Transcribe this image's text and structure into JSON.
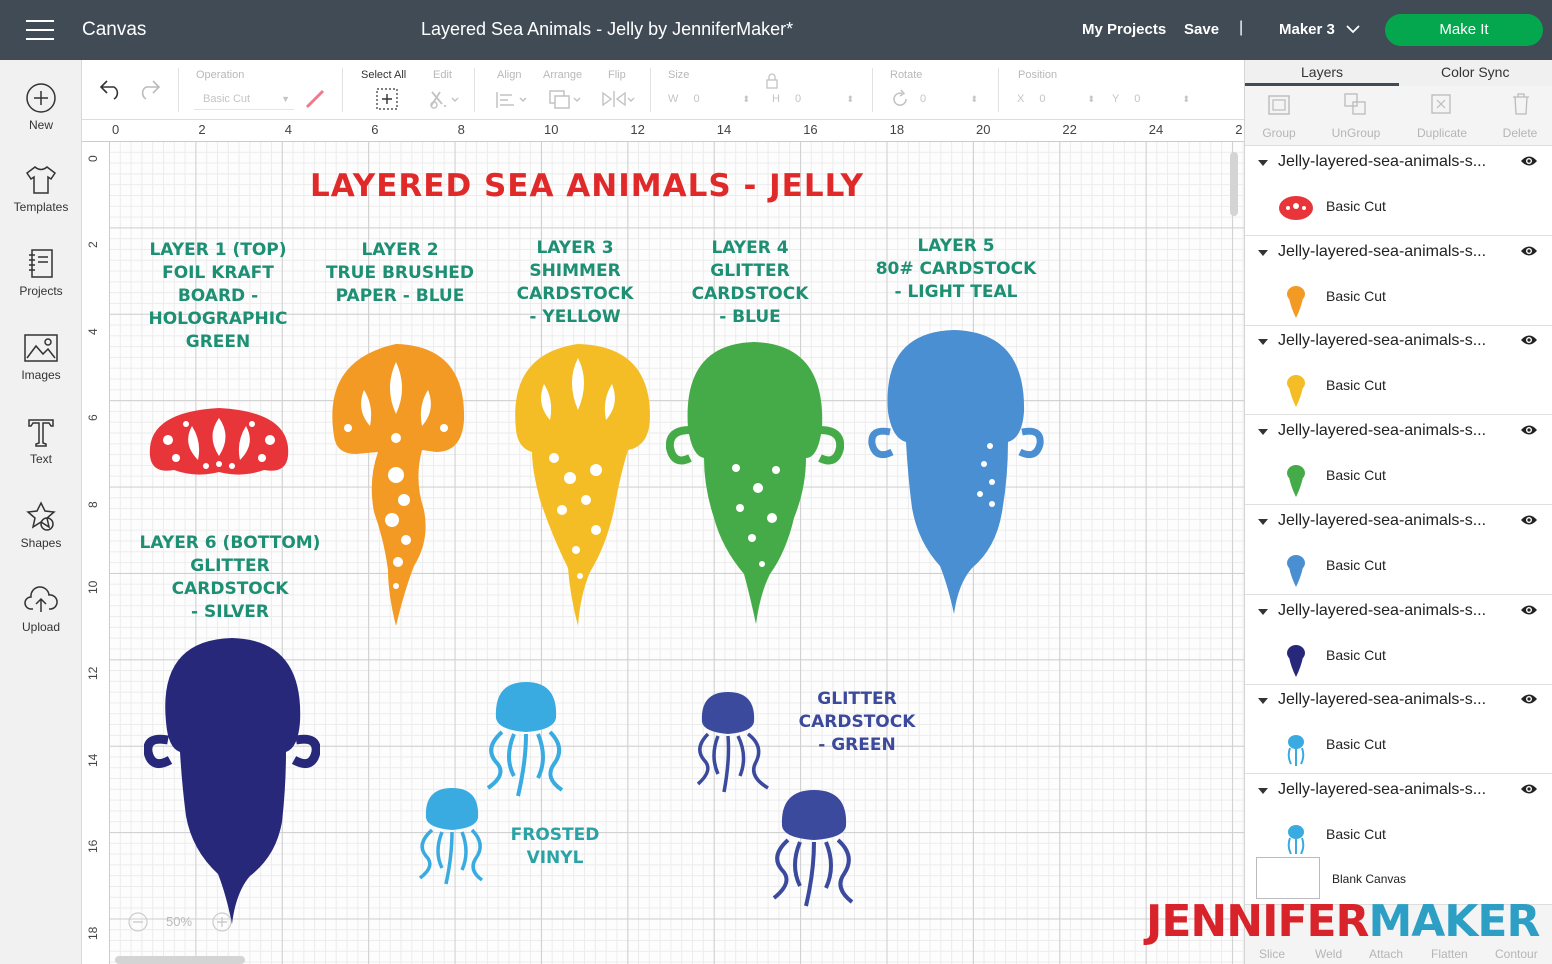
{
  "topbar": {
    "app_name": "Canvas",
    "doc_title": "Layered Sea Animals - Jelly by JenniferMaker*",
    "my_projects": "My Projects",
    "save": "Save",
    "separator": "|",
    "machine": "Maker 3",
    "make_it": "Make It",
    "make_it_color": "#04a74e"
  },
  "sidebar": {
    "items": [
      {
        "label": "New",
        "icon": "plus-circle-icon"
      },
      {
        "label": "Templates",
        "icon": "tshirt-icon"
      },
      {
        "label": "Projects",
        "icon": "notebook-icon"
      },
      {
        "label": "Images",
        "icon": "image-icon"
      },
      {
        "label": "Text",
        "icon": "text-icon"
      },
      {
        "label": "Shapes",
        "icon": "shapes-icon"
      },
      {
        "label": "Upload",
        "icon": "cloud-upload-icon"
      }
    ]
  },
  "toolbar": {
    "operation_label": "Operation",
    "operation_value": "Basic Cut",
    "select_all": "Select All",
    "edit": "Edit",
    "align": "Align",
    "arrange": "Arrange",
    "flip": "Flip",
    "size": "Size",
    "w": "W",
    "w_value": "0",
    "h": "H",
    "h_value": "0",
    "rotate": "Rotate",
    "rotate_value": "0",
    "position": "Position",
    "x": "X",
    "x_value": "0",
    "y": "Y",
    "y_value": "0"
  },
  "ruler": {
    "top": [
      "0",
      "2",
      "4",
      "6",
      "8",
      "10",
      "12",
      "14",
      "16",
      "18",
      "20",
      "22",
      "24",
      "2"
    ],
    "left": [
      "0",
      "2",
      "4",
      "6",
      "8",
      "10",
      "12",
      "14",
      "16",
      "18"
    ]
  },
  "canvas": {
    "title": "LAYERED SEA ANIMALS - JELLY",
    "labels": [
      "LAYER 1 (TOP)\nFOIL KRAFT\nBOARD -\nHOLOGRAPHIC\nGREEN",
      "LAYER 2\nTRUE BRUSHED\nPAPER - BLUE",
      "LAYER 3\nSHIMMER\nCARDSTOCK\n- YELLOW",
      "LAYER 4\nGLITTER\nCARDSTOCK\n- BLUE",
      "LAYER 5\n80# CARDSTOCK\n- LIGHT TEAL",
      "LAYER 6 (BOTTOM)\nGLITTER\nCARDSTOCK\n- SILVER"
    ],
    "note_frosted": "FROSTED\nVINYL",
    "note_glitter": "GLITTER\nCARDSTOCK\n- GREEN",
    "zoom": "50%",
    "colors": {
      "red": "#e8353a",
      "orange": "#f39a24",
      "yellow": "#f5bd25",
      "green": "#45ab48",
      "blue": "#4a8fd1",
      "navy": "#28287a",
      "sky": "#3aabe0",
      "indigo": "#3b4a9c",
      "label_teal": "#1d8f73",
      "frosted_teal": "#2aa3a6"
    }
  },
  "panel": {
    "tabs": [
      "Layers",
      "Color Sync"
    ],
    "actions": [
      "Group",
      "UnGroup",
      "Duplicate",
      "Delete"
    ],
    "layers": [
      {
        "name": "Jelly-layered-sea-animals-s...",
        "cut": "Basic Cut",
        "color": "#e8353a"
      },
      {
        "name": "Jelly-layered-sea-animals-s...",
        "cut": "Basic Cut",
        "color": "#f39a24"
      },
      {
        "name": "Jelly-layered-sea-animals-s...",
        "cut": "Basic Cut",
        "color": "#f5bd25"
      },
      {
        "name": "Jelly-layered-sea-animals-s...",
        "cut": "Basic Cut",
        "color": "#45ab48"
      },
      {
        "name": "Jelly-layered-sea-animals-s...",
        "cut": "Basic Cut",
        "color": "#4a8fd1"
      },
      {
        "name": "Jelly-layered-sea-animals-s...",
        "cut": "Basic Cut",
        "color": "#28287a"
      },
      {
        "name": "Jelly-layered-sea-animals-s...",
        "cut": "Basic Cut",
        "color": "#3aabe0"
      },
      {
        "name": "Jelly-layered-sea-animals-s...",
        "cut": "Basic Cut",
        "color": "#3aabe0"
      }
    ],
    "blank_canvas": "Blank Canvas",
    "bottom_actions": [
      "Slice",
      "Weld",
      "Attach",
      "Flatten",
      "Contour"
    ]
  },
  "brand": {
    "part1": "JENNIFER",
    "part2": "MAKER"
  }
}
